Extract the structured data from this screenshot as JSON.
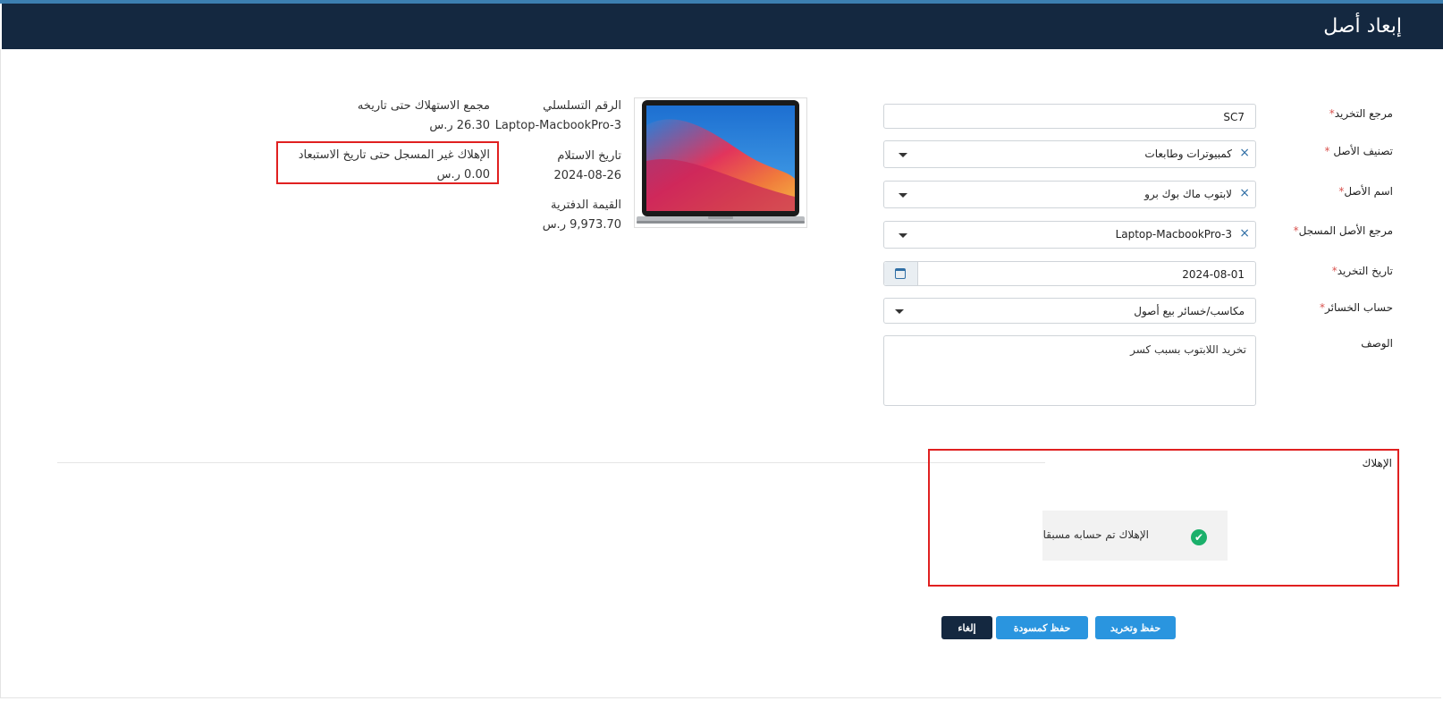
{
  "header": {
    "title": "إبعاد أصل"
  },
  "form": {
    "reference": {
      "label": "مرجع التخريد",
      "value": "SC7"
    },
    "category": {
      "label": "تصنيف الأصل",
      "value": "كمبيوترات وطابعات"
    },
    "asset_name": {
      "label": "اسم الأصل",
      "value": "لابتوب ماك بوك برو"
    },
    "asset_ref": {
      "label": "مرجع الأصل المسجل",
      "value": "Laptop-MacbookPro-3"
    },
    "date": {
      "label": "تاريخ التخريد",
      "value": "2024-08-01"
    },
    "loss_account": {
      "label": "حساب الخسائر",
      "value": "مكاسب/خسائر بيع أصول"
    },
    "description": {
      "label": "الوصف",
      "value": "تخريد اللابتوب بسبب كسر"
    },
    "required_mark": "*"
  },
  "asset_info": {
    "serial_label": "الرقم التسلسلي",
    "serial_value": "Laptop-MacbookPro-3",
    "received_label": "تاريخ الاستلام",
    "received_value": "2024-08-26",
    "book_value_label": "القيمة الدفترية",
    "book_value_value": "9,973.70 ر.س",
    "accum_label": "مجمع الاستهلاك حتى تاريخه",
    "accum_value": "26.30 ر.س",
    "unrecorded_label": "الإهلاك غير المسجل حتى تاريخ الاستبعاد",
    "unrecorded_value": "0.00 ر.س"
  },
  "depreciation": {
    "title": "الإهلاك",
    "message": "الإهلاك تم حسابه مسبقا",
    "check_icon": "✔"
  },
  "buttons": {
    "save_scrap": "حفظ وتخريد",
    "save_draft": "حفظ كمسودة",
    "cancel": "إلغاء"
  },
  "icons": {
    "clear": "×"
  },
  "colors": {
    "header": "#142840",
    "primary": "#2a95df",
    "success": "#1bb06b",
    "highlight": "#e02020"
  }
}
